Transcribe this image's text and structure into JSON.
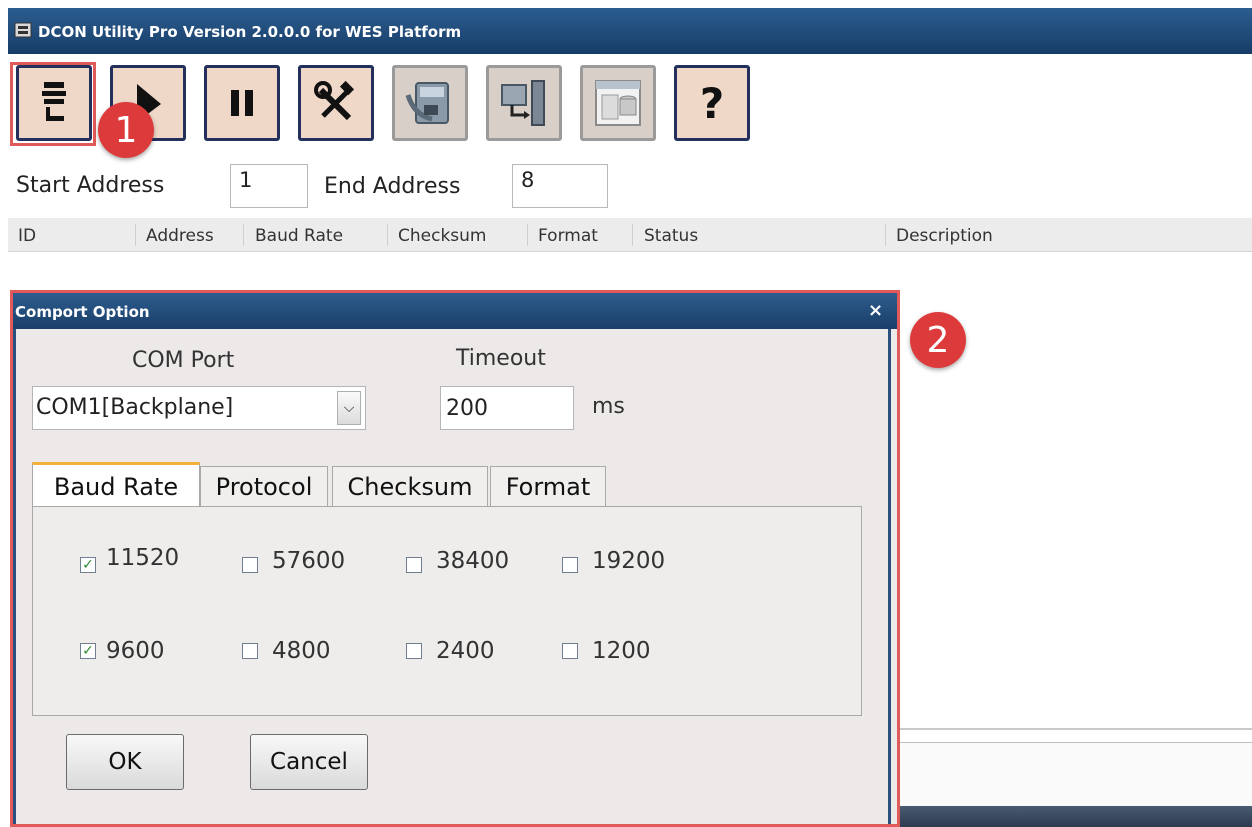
{
  "window": {
    "title": "DCON Utility Pro Version 2.0.0.0 for WES Platform"
  },
  "toolbar": {
    "buttons": [
      {
        "name": "comport-option-icon"
      },
      {
        "name": "search-icon"
      },
      {
        "name": "pause-icon"
      },
      {
        "name": "tools-icon"
      },
      {
        "name": "module-icon"
      },
      {
        "name": "io-icon"
      },
      {
        "name": "database-window-icon"
      },
      {
        "name": "help-icon"
      }
    ]
  },
  "annotations": {
    "badge1": "1",
    "badge2": "2",
    "highlight_color": "#e05a5a"
  },
  "address": {
    "start_label": "Start Address",
    "start_value": "1",
    "end_label": "End Address",
    "end_value": "8"
  },
  "table": {
    "columns": [
      "ID",
      "Address",
      "Baud Rate",
      "Checksum",
      "Format",
      "Status",
      "Description"
    ]
  },
  "dialog": {
    "title": "Comport Option",
    "close": "×",
    "com_port_label": "COM Port",
    "com_port_value": "COM1[Backplane]",
    "timeout_label": "Timeout",
    "timeout_value": "200",
    "timeout_unit": "ms",
    "tabs": [
      "Baud Rate",
      "Protocol",
      "Checksum",
      "Format"
    ],
    "active_tab": "Baud Rate",
    "baud_rates": [
      {
        "label": "11520",
        "checked": true
      },
      {
        "label": "57600",
        "checked": false
      },
      {
        "label": "38400",
        "checked": false
      },
      {
        "label": "19200",
        "checked": false
      },
      {
        "label": "9600",
        "checked": true
      },
      {
        "label": "4800",
        "checked": false
      },
      {
        "label": "2400",
        "checked": false
      },
      {
        "label": "1200",
        "checked": false
      }
    ],
    "ok_label": "OK",
    "cancel_label": "Cancel"
  }
}
